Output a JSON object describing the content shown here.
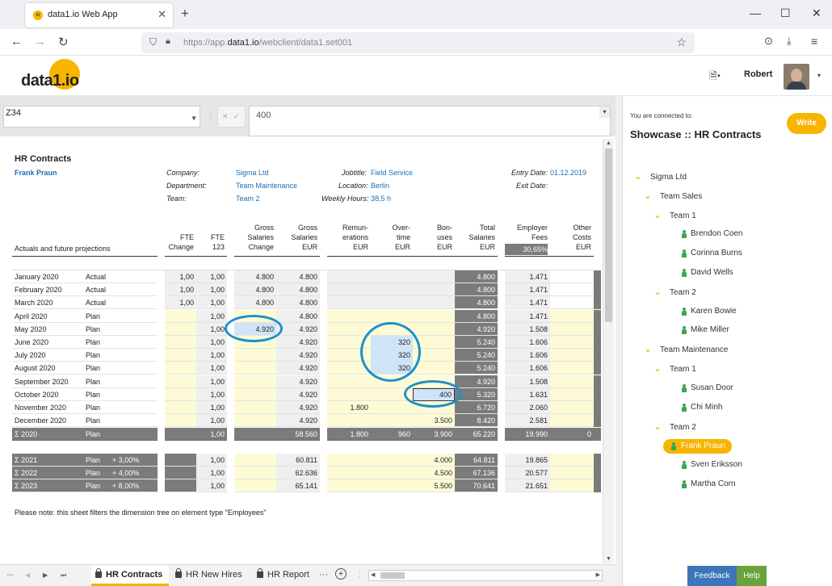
{
  "browser": {
    "tab_title": "data1.io Web App",
    "tab_favicon_text": "io",
    "url_prefix": "https://app.",
    "url_domain": "data1.io",
    "url_path": "/webclient/data1.set001"
  },
  "app": {
    "logo_text": "data1.io",
    "user_name": "Robert"
  },
  "formula_bar": {
    "cell_ref": "Z34",
    "value": "400"
  },
  "sheet": {
    "title": "HR Contracts",
    "employee": "Frank Praun",
    "info": {
      "company_label": "Company:",
      "company": "Sigma Ltd",
      "department_label": "Department:",
      "department": "Team Maintenance",
      "team_label": "Team:",
      "team": "Team 2",
      "jobtitle_label": "Jobtitle:",
      "jobtitle": "Field Service",
      "location_label": "Location:",
      "location": "Berlin",
      "hours_label": "Weekly Hours:",
      "hours": "38,5  h",
      "entry_label": "Entry Date:",
      "entry": "01.12.2019",
      "exit_label": "Exit Date:",
      "exit": ""
    },
    "section_label": "Actuals and future projections",
    "headers": [
      {
        "line1": "",
        "line2": "FTE",
        "line3": "Change"
      },
      {
        "line1": "",
        "line2": "FTE",
        "line3": "123"
      },
      {
        "line1": "Gross",
        "line2": "Salaries",
        "line3": "Change"
      },
      {
        "line1": "Gross",
        "line2": "Salaries",
        "line3": "EUR"
      },
      {
        "line1": "Remun-",
        "line2": "erations",
        "line3": "EUR"
      },
      {
        "line1": "Over-",
        "line2": "time",
        "line3": "EUR"
      },
      {
        "line1": "Bon-",
        "line2": "uses",
        "line3": "EUR"
      },
      {
        "line1": "Total",
        "line2": "Salaries",
        "line3": "EUR"
      },
      {
        "line1": "Employer",
        "line2": "Fees",
        "line3": "30,65%"
      },
      {
        "line1": "Other",
        "line2": "Costs",
        "line3": "EUR"
      }
    ],
    "rows": [
      {
        "month": "January 2020",
        "type": "Actual",
        "fte_change": "1,00",
        "fte": "1,00",
        "gs_change": "4.800",
        "gs": "4.800",
        "rem": "",
        "ot": "",
        "bon": "",
        "total": "4.800",
        "fees": "1.471",
        "other": ""
      },
      {
        "month": "February 2020",
        "type": "Actual",
        "fte_change": "1,00",
        "fte": "1,00",
        "gs_change": "4.800",
        "gs": "4.800",
        "rem": "",
        "ot": "",
        "bon": "",
        "total": "4.800",
        "fees": "1.471",
        "other": ""
      },
      {
        "month": "March 2020",
        "type": "Actual",
        "fte_change": "1,00",
        "fte": "1,00",
        "gs_change": "4.800",
        "gs": "4.800",
        "rem": "",
        "ot": "",
        "bon": "",
        "total": "4.800",
        "fees": "1.471",
        "other": ""
      },
      {
        "month": "April 2020",
        "type": "Plan",
        "fte_change": "",
        "fte": "1,00",
        "gs_change": "",
        "gs": "4.800",
        "rem": "",
        "ot": "",
        "bon": "",
        "total": "4.800",
        "fees": "1.471",
        "other": ""
      },
      {
        "month": "May 2020",
        "type": "Plan",
        "fte_change": "",
        "fte": "1,00",
        "gs_change": "4.920",
        "gs": "4.920",
        "rem": "",
        "ot": "",
        "bon": "",
        "total": "4.920",
        "fees": "1.508",
        "other": ""
      },
      {
        "month": "June 2020",
        "type": "Plan",
        "fte_change": "",
        "fte": "1,00",
        "gs_change": "",
        "gs": "4.920",
        "rem": "",
        "ot": "320",
        "bon": "",
        "total": "5.240",
        "fees": "1.606",
        "other": ""
      },
      {
        "month": "July 2020",
        "type": "Plan",
        "fte_change": "",
        "fte": "1,00",
        "gs_change": "",
        "gs": "4.920",
        "rem": "",
        "ot": "320",
        "bon": "",
        "total": "5.240",
        "fees": "1.606",
        "other": ""
      },
      {
        "month": "August 2020",
        "type": "Plan",
        "fte_change": "",
        "fte": "1,00",
        "gs_change": "",
        "gs": "4.920",
        "rem": "",
        "ot": "320",
        "bon": "",
        "total": "5.240",
        "fees": "1.606",
        "other": ""
      },
      {
        "month": "September 2020",
        "type": "Plan",
        "fte_change": "",
        "fte": "1,00",
        "gs_change": "",
        "gs": "4.920",
        "rem": "",
        "ot": "",
        "bon": "",
        "total": "4.920",
        "fees": "1.508",
        "other": ""
      },
      {
        "month": "October 2020",
        "type": "Plan",
        "fte_change": "",
        "fte": "1,00",
        "gs_change": "",
        "gs": "4.920",
        "rem": "",
        "ot": "",
        "bon": "400",
        "total": "5.320",
        "fees": "1.631",
        "other": ""
      },
      {
        "month": "November 2020",
        "type": "Plan",
        "fte_change": "",
        "fte": "1,00",
        "gs_change": "",
        "gs": "4.920",
        "rem": "1.800",
        "ot": "",
        "bon": "",
        "total": "6.720",
        "fees": "2.060",
        "other": ""
      },
      {
        "month": "December 2020",
        "type": "Plan",
        "fte_change": "",
        "fte": "1,00",
        "gs_change": "",
        "gs": "4.920",
        "rem": "",
        "ot": "",
        "bon": "3.500",
        "total": "8.420",
        "fees": "2.581",
        "other": ""
      }
    ],
    "sum_2020": {
      "month": "Σ 2020",
      "type": "Plan",
      "fte_change": "",
      "fte": "1,00",
      "gs_change": "",
      "gs": "58.560",
      "rem": "1.800",
      "ot": "960",
      "bon": "3.900",
      "total": "65.220",
      "fees": "19.990",
      "other": "0"
    },
    "year_rows": [
      {
        "month": "Σ 2021",
        "type": "Plan",
        "growth": "+  3,00%",
        "fte": "1,00",
        "gs": "60.811",
        "bon": "4.000",
        "total": "64.811",
        "fees": "19.865"
      },
      {
        "month": "Σ 2022",
        "type": "Plan",
        "growth": "+  4,00%",
        "fte": "1,00",
        "gs": "62.636",
        "bon": "4.500",
        "total": "67.136",
        "fees": "20.577"
      },
      {
        "month": "Σ 2023",
        "type": "Plan",
        "growth": "+  8,00%",
        "fte": "1,00",
        "gs": "65.141",
        "bon": "5.500",
        "total": "70.641",
        "fees": "21.651"
      }
    ],
    "note": "Please note: this sheet filters the dimension tree on element type \"Employees\""
  },
  "sheet_tabs": [
    {
      "label": "HR Contracts",
      "active": true
    },
    {
      "label": "HR New Hires",
      "active": false
    },
    {
      "label": "HR Report",
      "active": false
    }
  ],
  "right_panel": {
    "connected_label": "You are connected to:",
    "db_name": "Showcase :: HR Contracts",
    "write_label": "Write",
    "tree": {
      "company": "Sigma Ltd",
      "dept1": "Team Sales",
      "team1": "Team 1",
      "p1": "Brendon Coen",
      "p2": "Corinna Burns",
      "p3": "David Wells",
      "team2": "Team 2",
      "p4": "Karen Bowie",
      "p5": "Mike Miller",
      "dept2": "Team Maintenance",
      "team3": "Team 1",
      "p6": "Susan Door",
      "p7": "Chi Minh",
      "team4": "Team 2",
      "p8": "Frank Praun",
      "p9": "Sven Eriksson",
      "p10": "Martha Corn"
    },
    "feedback_label": "Feedback",
    "help_label": "Help"
  },
  "colors": {
    "accent": "#f7b500",
    "input_yellow": "#fdfbd6",
    "dark_gray": "#7b7b7b",
    "annotation_blue": "#1e90c8",
    "link_blue": "#1a6eb5"
  }
}
